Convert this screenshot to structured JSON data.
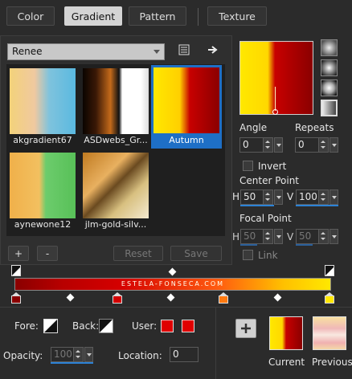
{
  "tabs": [
    {
      "label": "Color",
      "active": false
    },
    {
      "label": "Gradient",
      "active": true
    },
    {
      "label": "Pattern",
      "active": false
    },
    {
      "label": "Texture",
      "active": false
    }
  ],
  "category": "Renee",
  "gallery": [
    {
      "label": "akgradient67",
      "selected": false
    },
    {
      "label": "ASDwebs_Gr...",
      "selected": false
    },
    {
      "label": "Autumn",
      "selected": true
    },
    {
      "label": "aynewone12",
      "selected": false
    },
    {
      "label": "jlm-gold-silv...",
      "selected": false
    }
  ],
  "buttons": {
    "add": "+",
    "remove": "-",
    "reset": "Reset",
    "save": "Save"
  },
  "angle": {
    "label": "Angle",
    "value": "0"
  },
  "repeats": {
    "label": "Repeats",
    "value": "0"
  },
  "invert": {
    "label": "Invert",
    "checked": false
  },
  "center_point": {
    "label": "Center Point",
    "h_label": "H",
    "h": "50",
    "v_label": "V",
    "v": "100"
  },
  "focal_point": {
    "label": "Focal Point",
    "h_label": "H",
    "h": "50",
    "v_label": "V",
    "v": "50"
  },
  "link": {
    "label": "Link",
    "checked": false
  },
  "gradient_bar": {
    "credit": "ESTELA-FONSECA.COM"
  },
  "fore": {
    "label": "Fore:"
  },
  "back": {
    "label": "Back:"
  },
  "user": {
    "label": "User:",
    "color1": "#e00000",
    "color2": "#e00000"
  },
  "opacity": {
    "label": "Opacity:",
    "value": "100"
  },
  "location": {
    "label": "Location:",
    "value": "0"
  },
  "current": {
    "label": "Current"
  },
  "previous": {
    "label": "Previous"
  },
  "colors": {
    "accent": "#1e6fc6",
    "bg": "#2b2b2b"
  }
}
